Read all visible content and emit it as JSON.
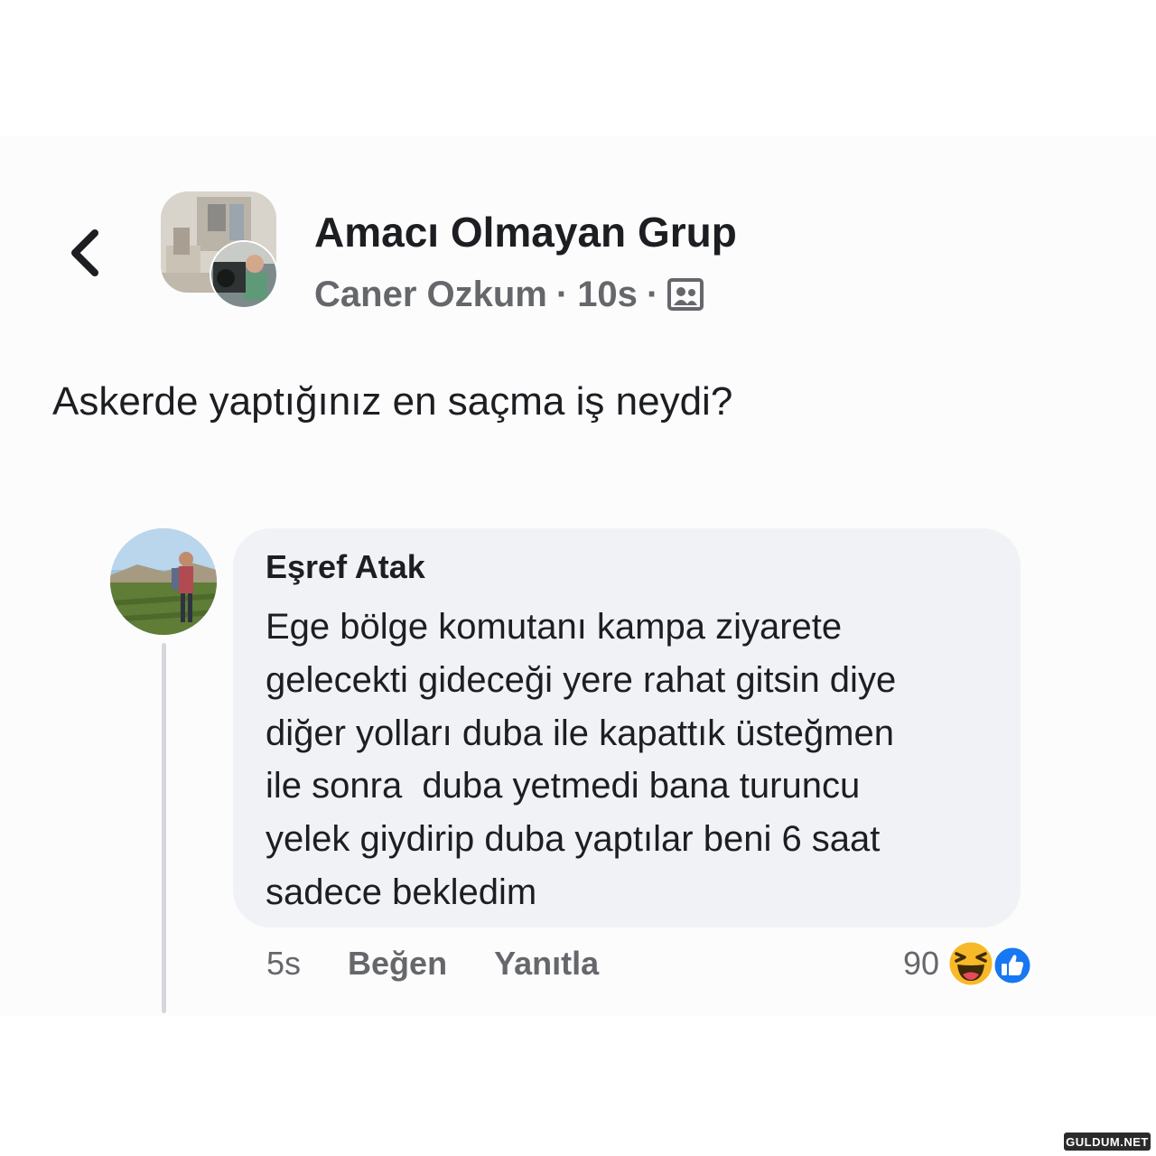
{
  "header": {
    "back_icon": "chevron-left-icon",
    "group_name": "Amacı Olmayan Grup",
    "author": "Caner Ozkum",
    "time": "10s",
    "separator": "·",
    "audience_icon": "group-audience-icon"
  },
  "post": {
    "text": "Askerde yaptığınız en saçma iş neydi?"
  },
  "comment": {
    "author": "Eşref Atak",
    "lines": [
      "Ege bölge komutanı kampa ziyarete",
      "gelecekti gideceği yere rahat gitsin diye",
      "diğer yolları duba ile kapattık üsteğmen",
      "ile sonra  duba yetmedi bana turuncu",
      "yelek giydirip duba yaptılar beni 6 saat",
      "sadece bekledim"
    ],
    "time": "5s",
    "like_label": "Beğen",
    "reply_label": "Yanıtla",
    "reaction_count": "90",
    "reaction_icons": [
      "haha-icon",
      "like-icon"
    ]
  },
  "watermark": "GULDUM.NET",
  "colors": {
    "text_primary": "#1c1e21",
    "text_secondary": "#65676b",
    "bubble": "#f0f2f5",
    "like_blue": "#1877f2",
    "haha_yellow": "#f7b928"
  }
}
